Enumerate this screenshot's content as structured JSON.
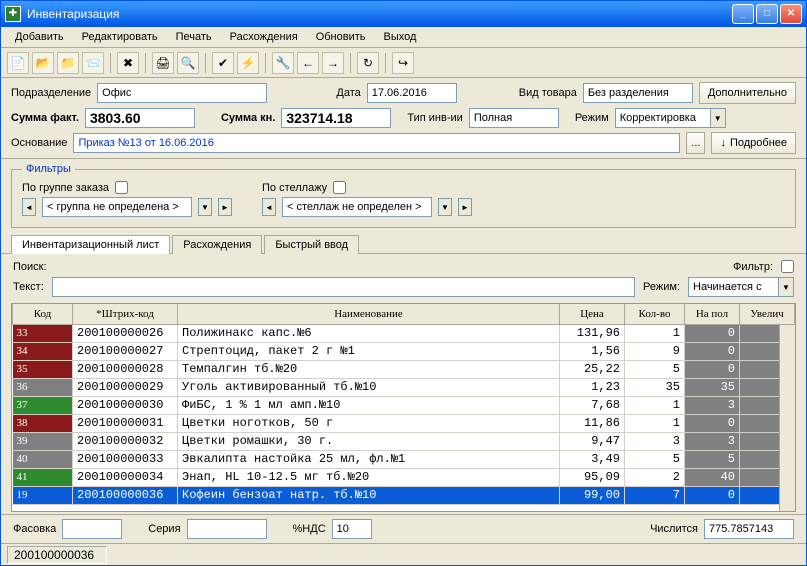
{
  "window": {
    "title": "Инвентаризация"
  },
  "menu": {
    "add": "Добавить",
    "edit": "Редактировать",
    "print": "Печать",
    "diff": "Расхождения",
    "refresh": "Обновить",
    "exit": "Выход"
  },
  "form": {
    "dept_label": "Подразделение",
    "dept": "Офис",
    "date_label": "Дата",
    "date": "17.06.2016",
    "goodtype_label": "Вид товара",
    "goodtype": "Без разделения",
    "extra": "Дополнительно",
    "sumfact_label": "Сумма факт.",
    "sumfact": "3803.60",
    "sumkn_label": "Сумма кн.",
    "sumkn": "323714.18",
    "invtype_label": "Тип инв-ии",
    "invtype": "Полная",
    "mode_label": "Режим",
    "mode": "Корректировка",
    "basis_label": "Основание",
    "basis": "Приказ №13 от 16.06.2016",
    "more": "Подробнее"
  },
  "filters": {
    "legend": "Фильтры",
    "bygroup": "По группе заказа",
    "group": "< группа не определена >",
    "byrack": "По стеллажу",
    "rack": "< стеллаж не определен >"
  },
  "tabs": {
    "t1": "Инвентаризационный лист",
    "t2": "Расхождения",
    "t3": "Быстрый ввод"
  },
  "search": {
    "search": "Поиск:",
    "text": "Текст:",
    "filter": "Фильтр:",
    "mode": "Режим:",
    "modeval": "Начинается с"
  },
  "columns": {
    "code": "Код",
    "barcode": "*Штрих-код",
    "name": "Наименование",
    "price": "Цена",
    "qty": "Кол-во",
    "shelf": "На пол",
    "inc": "Увелич"
  },
  "rows": [
    {
      "code": "33",
      "color": "#8b1a1a",
      "barcode": "200100000026",
      "name": "Полижинакс капс.№6",
      "price": "131,96",
      "qty": "1",
      "shelf": "0"
    },
    {
      "code": "34",
      "color": "#8b1a1a",
      "barcode": "200100000027",
      "name": "Стрептоцид, пакет 2 г №1",
      "price": "1,56",
      "qty": "9",
      "shelf": "0"
    },
    {
      "code": "35",
      "color": "#8b1a1a",
      "barcode": "200100000028",
      "name": "Темпалгин тб.№20",
      "price": "25,22",
      "qty": "5",
      "shelf": "0"
    },
    {
      "code": "36",
      "color": "#808080",
      "barcode": "200100000029",
      "name": "Уголь активированный тб.№10",
      "price": "1,23",
      "qty": "35",
      "shelf": "35"
    },
    {
      "code": "37",
      "color": "#2e8b2e",
      "barcode": "200100000030",
      "name": "ФиБС, 1 % 1 мл амп.№10",
      "price": "7,68",
      "qty": "1",
      "shelf": "3"
    },
    {
      "code": "38",
      "color": "#8b1a1a",
      "barcode": "200100000031",
      "name": "Цветки ноготков, 50 г",
      "price": "11,86",
      "qty": "1",
      "shelf": "0"
    },
    {
      "code": "39",
      "color": "#808080",
      "barcode": "200100000032",
      "name": "Цветки ромашки, 30 г.",
      "price": "9,47",
      "qty": "3",
      "shelf": "3"
    },
    {
      "code": "40",
      "color": "#808080",
      "barcode": "200100000033",
      "name": "Эвкалипта настойка 25 мл, фл.№1",
      "price": "3,49",
      "qty": "5",
      "shelf": "5"
    },
    {
      "code": "41",
      "color": "#2e8b2e",
      "barcode": "200100000034",
      "name": "Энап, HL 10-12.5 мг тб.№20",
      "price": "95,09",
      "qty": "2",
      "shelf": "40"
    },
    {
      "code": "19",
      "color": "#0a5cd7",
      "barcode": "200100000036",
      "name": "Кофеин бензоат натр. тб.№10",
      "price": "99,00",
      "qty": "7",
      "shelf": "0",
      "sel": true
    }
  ],
  "bottom": {
    "pack": "Фасовка",
    "series": "Серия",
    "vat": "%НДС",
    "vatval": "10",
    "calc": "Числится",
    "calcval": "775.7857143"
  },
  "status": {
    "val": "200100000036"
  }
}
